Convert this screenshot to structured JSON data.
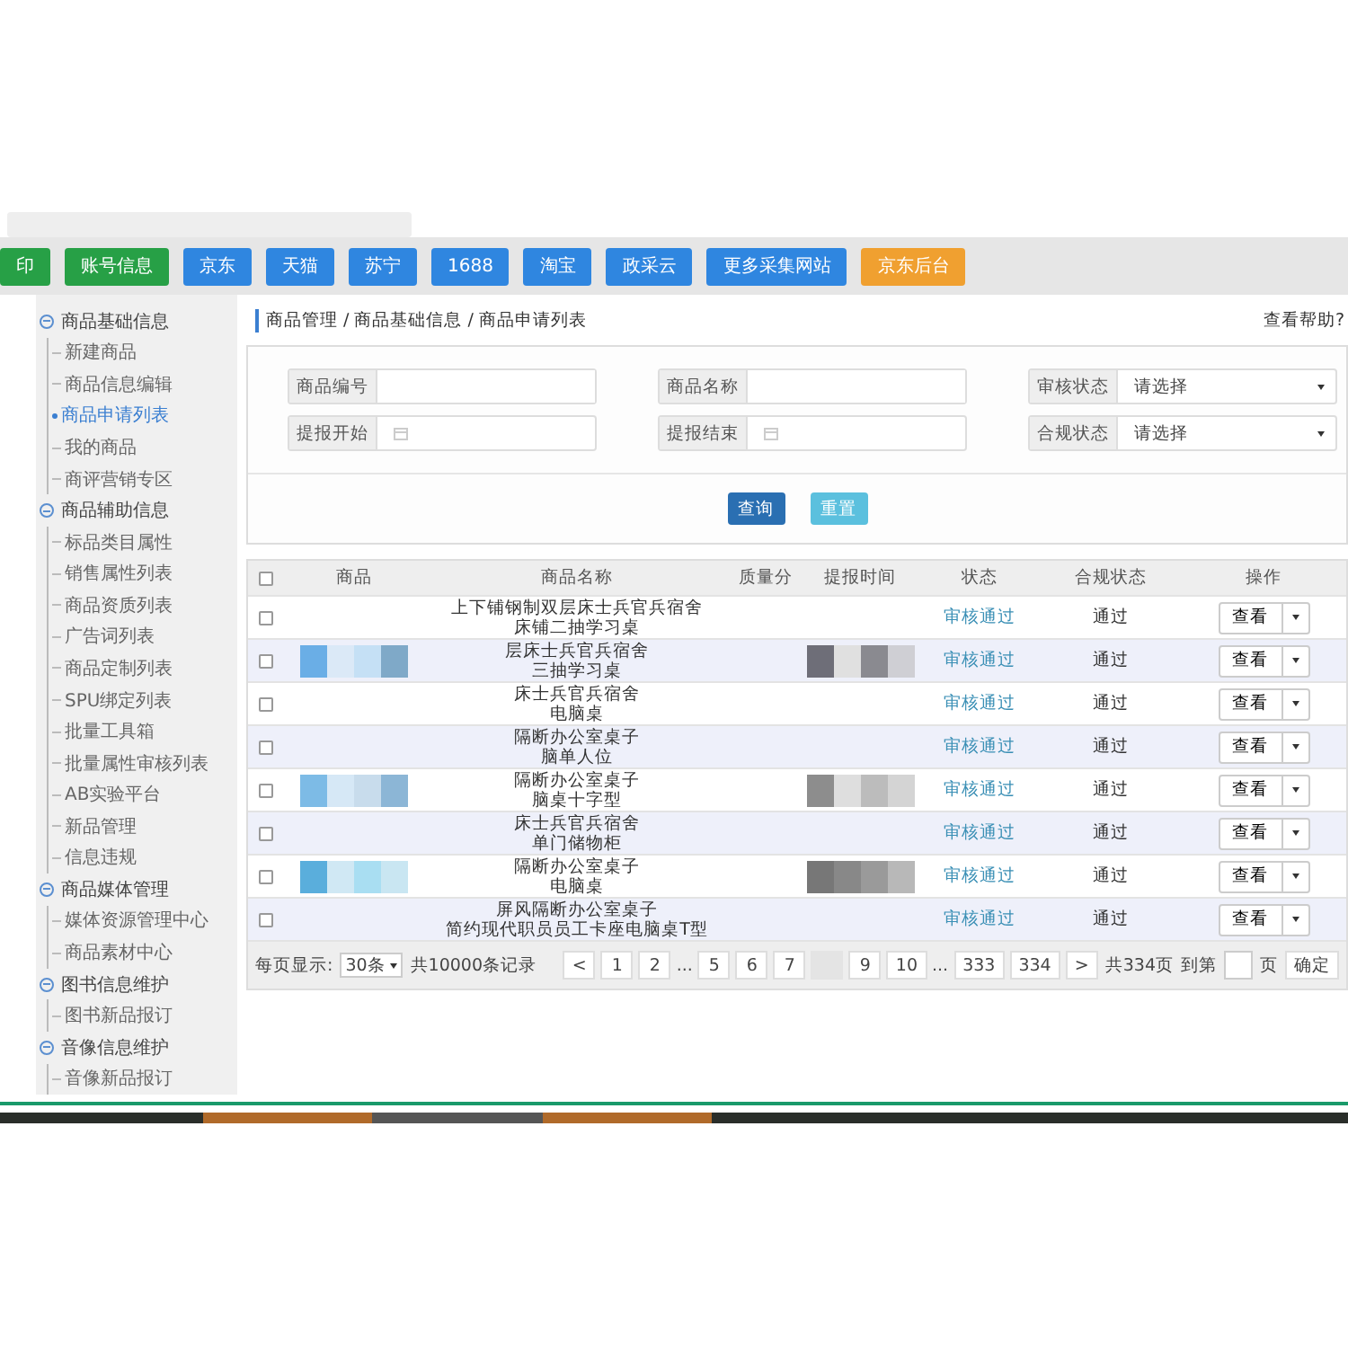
{
  "toolbar": [
    {
      "label": "印",
      "color": "#27a046"
    },
    {
      "label": "账号信息",
      "color": "#27a046"
    },
    {
      "label": "京东",
      "color": "#2f86e0"
    },
    {
      "label": "天猫",
      "color": "#2f86e0"
    },
    {
      "label": "苏宁",
      "color": "#2f86e0"
    },
    {
      "label": "1688",
      "color": "#2f86e0"
    },
    {
      "label": "淘宝",
      "color": "#2f86e0"
    },
    {
      "label": "政采云",
      "color": "#2f86e0"
    },
    {
      "label": "更多采集网站",
      "color": "#2f86e0"
    },
    {
      "label": "京东后台",
      "color": "#f0a030"
    }
  ],
  "sidebar": [
    {
      "label": "商品基础信息",
      "children": [
        {
          "label": "新建商品",
          "selected": false
        },
        {
          "label": "商品信息编辑",
          "selected": false
        },
        {
          "label": "商品申请列表",
          "selected": true
        },
        {
          "label": "我的商品",
          "selected": false
        },
        {
          "label": "商评营销专区",
          "selected": false
        }
      ]
    },
    {
      "label": "商品辅助信息",
      "children": [
        {
          "label": "标品类目属性",
          "selected": false
        },
        {
          "label": "销售属性列表",
          "selected": false
        },
        {
          "label": "商品资质列表",
          "selected": false
        },
        {
          "label": "广告词列表",
          "selected": false
        },
        {
          "label": "商品定制列表",
          "selected": false
        },
        {
          "label": "SPU绑定列表",
          "selected": false
        },
        {
          "label": "批量工具箱",
          "selected": false
        },
        {
          "label": "批量属性审核列表",
          "selected": false
        },
        {
          "label": "AB实验平台",
          "selected": false
        },
        {
          "label": "新品管理",
          "selected": false
        },
        {
          "label": "信息违规",
          "selected": false
        }
      ]
    },
    {
      "label": "商品媒体管理",
      "children": [
        {
          "label": "媒体资源管理中心",
          "selected": false
        },
        {
          "label": "商品素材中心",
          "selected": false
        }
      ]
    },
    {
      "label": "图书信息维护",
      "children": [
        {
          "label": "图书新品报订",
          "selected": false
        }
      ]
    },
    {
      "label": "音像信息维护",
      "children": [
        {
          "label": "音像新品报订",
          "selected": false
        }
      ]
    }
  ],
  "breadcrumb": "商品管理 / 商品基础信息 / 商品申请列表",
  "help_link": "查看帮助?",
  "filters": [
    {
      "kind": "text",
      "label": "商品编号"
    },
    {
      "kind": "text",
      "label": "商品名称"
    },
    {
      "kind": "select",
      "label": "审核状态",
      "placeholder": "请选择"
    },
    {
      "kind": "date",
      "label": "提报开始"
    },
    {
      "kind": "date",
      "label": "提报结束"
    },
    {
      "kind": "select",
      "label": "合规状态",
      "placeholder": "请选择"
    }
  ],
  "buttons": [
    {
      "label": "查询",
      "kind": "primary"
    },
    {
      "label": "重置",
      "kind": "info"
    }
  ],
  "table": {
    "select_all_checked": false,
    "columns": [
      "商品",
      "商品名称",
      "质量分",
      "提报时间",
      "状态",
      "合规状态",
      "操作"
    ],
    "rows": [
      {
        "name": [
          "上下铺钢制双层床士兵官兵宿舍",
          "床铺二抽学习桌"
        ],
        "checked": false,
        "status": "审核通过",
        "compliance": "通过",
        "action": "查看"
      },
      {
        "name": [
          "层床士兵官兵宿舍",
          "三抽学习桌"
        ],
        "checked": false,
        "status": "审核通过",
        "compliance": "通过",
        "action": "查看"
      },
      {
        "name": [
          "床士兵官兵宿舍",
          "电脑桌"
        ],
        "checked": false,
        "status": "审核通过",
        "compliance": "通过",
        "action": "查看"
      },
      {
        "name": [
          "隔断办公室桌子",
          "脑单人位"
        ],
        "checked": false,
        "status": "审核通过",
        "compliance": "通过",
        "action": "查看"
      },
      {
        "name": [
          "隔断办公室桌子",
          "脑桌十字型"
        ],
        "checked": false,
        "status": "审核通过",
        "compliance": "通过",
        "action": "查看"
      },
      {
        "name": [
          "床士兵官兵宿舍",
          "单门储物柜"
        ],
        "checked": false,
        "status": "审核通过",
        "compliance": "通过",
        "action": "查看"
      },
      {
        "name": [
          "隔断办公室桌子",
          "电脑桌"
        ],
        "checked": false,
        "status": "审核通过",
        "compliance": "通过",
        "action": "查看"
      },
      {
        "name": [
          "屏风隔断办公室桌子",
          "简约现代职员员工卡座电脑桌T型"
        ],
        "checked": false,
        "status": "审核通过",
        "compliance": "通过",
        "action": "查看"
      }
    ]
  },
  "pagination": {
    "per_page_label": "每页显示:",
    "per_page": "30条",
    "total": "共10000条记录",
    "pages": [
      {
        "kind": "page",
        "label": "<"
      },
      {
        "kind": "page",
        "label": "1"
      },
      {
        "kind": "page",
        "label": "2"
      },
      {
        "kind": "gap",
        "label": "..."
      },
      {
        "kind": "page",
        "label": "5"
      },
      {
        "kind": "page",
        "label": "6"
      },
      {
        "kind": "page",
        "label": "7"
      },
      {
        "kind": "blank"
      },
      {
        "kind": "page",
        "label": "9"
      },
      {
        "kind": "page",
        "label": "10"
      },
      {
        "kind": "gap",
        "label": "..."
      },
      {
        "kind": "page",
        "label": "333"
      },
      {
        "kind": "page",
        "label": "334"
      },
      {
        "kind": "page",
        "label": ">"
      }
    ],
    "page_count": "共334页",
    "goto_label": "到第",
    "page_unit": "页",
    "confirm": "确定"
  }
}
